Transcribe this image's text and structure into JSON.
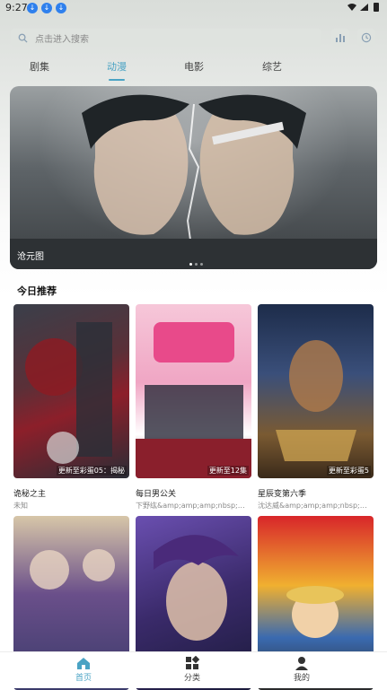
{
  "status": {
    "time": "9:27",
    "icons": [
      "download-icon",
      "download-icon",
      "download-icon"
    ]
  },
  "search": {
    "placeholder": "点击进入搜索"
  },
  "tabs": [
    {
      "label": "剧集",
      "active": false
    },
    {
      "label": "动漫",
      "active": true
    },
    {
      "label": "电影",
      "active": false
    },
    {
      "label": "综艺",
      "active": false
    }
  ],
  "banner": {
    "title": "沧元图"
  },
  "section": {
    "title": "今日推荐"
  },
  "cards": [
    {
      "title": "诡秘之主",
      "actors": "未知",
      "badge": "更新至彩蛋05：揭秘"
    },
    {
      "title": "每日男公关",
      "actors": "下野纮&amp;amp;amp;nbsp;八…",
      "badge": "更新至12集"
    },
    {
      "title": "星辰变第六季",
      "actors": "沈达威&amp;amp;amp;nbsp;吴…",
      "badge": "更新至彩蛋5"
    },
    {
      "title": "",
      "actors": "",
      "badge": ""
    },
    {
      "title": "",
      "actors": "",
      "badge": ""
    },
    {
      "title": "",
      "actors": "",
      "badge": ""
    }
  ],
  "nav": [
    {
      "label": "首页",
      "icon": "home-icon",
      "active": true
    },
    {
      "label": "分类",
      "icon": "grid-icon",
      "active": false
    },
    {
      "label": "我的",
      "icon": "person-icon",
      "active": false
    }
  ],
  "colors": {
    "accent": "#4aa3c4"
  }
}
